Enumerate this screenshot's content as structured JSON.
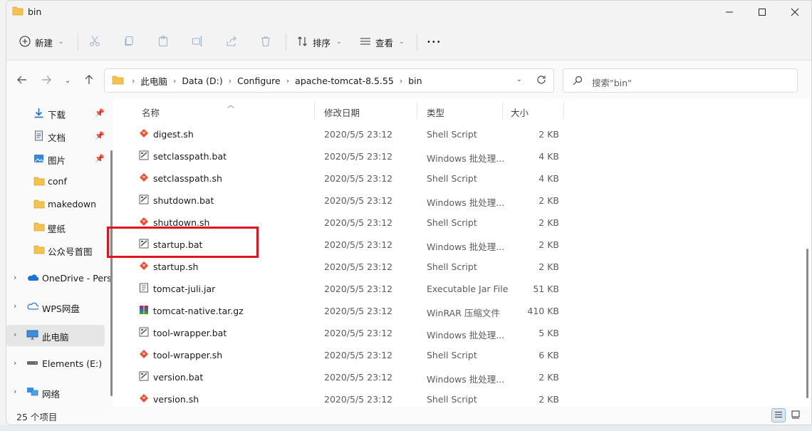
{
  "window": {
    "title": "bin"
  },
  "toolbar": {
    "new_label": "新建",
    "sort_label": "排序",
    "view_label": "查看",
    "more_label": "•••"
  },
  "address": {
    "crumbs": [
      "此电脑",
      "Data (D:)",
      "Configure",
      "apache-tomcat-8.5.55",
      "bin"
    ]
  },
  "search": {
    "placeholder": "搜索\"bin\""
  },
  "sidebar": {
    "quick": [
      {
        "label": "下载",
        "icon": "download-icon",
        "pinned": true
      },
      {
        "label": "文档",
        "icon": "document-icon",
        "pinned": true
      },
      {
        "label": "图片",
        "icon": "picture-icon",
        "pinned": true
      },
      {
        "label": "conf",
        "icon": "folder-icon"
      },
      {
        "label": "makedown",
        "icon": "folder-icon"
      },
      {
        "label": "壁纸",
        "icon": "folder-icon"
      },
      {
        "label": "公众号首图",
        "icon": "folder-icon"
      }
    ],
    "top": [
      {
        "label": "OneDrive - Pers",
        "icon": "onedrive-icon"
      },
      {
        "label": "WPS网盘",
        "icon": "wps-cloud-icon"
      },
      {
        "label": "此电脑",
        "icon": "this-pc-icon"
      },
      {
        "label": "Elements (E:)",
        "icon": "drive-icon"
      },
      {
        "label": "网络",
        "icon": "network-icon"
      }
    ]
  },
  "columns": {
    "name": "名称",
    "date": "修改日期",
    "type": "类型",
    "size": "大小"
  },
  "files": [
    {
      "name": "digest.sh",
      "date": "2020/5/5 23:12",
      "type": "Shell Script",
      "size": "2 KB",
      "icon": "shell-script-icon"
    },
    {
      "name": "setclasspath.bat",
      "date": "2020/5/5 23:12",
      "type": "Windows 批处理...",
      "size": "4 KB",
      "icon": "batch-file-icon"
    },
    {
      "name": "setclasspath.sh",
      "date": "2020/5/5 23:12",
      "type": "Shell Script",
      "size": "4 KB",
      "icon": "shell-script-icon"
    },
    {
      "name": "shutdown.bat",
      "date": "2020/5/5 23:12",
      "type": "Windows 批处理...",
      "size": "2 KB",
      "icon": "batch-file-icon"
    },
    {
      "name": "shutdown.sh",
      "date": "2020/5/5 23:12",
      "type": "Shell Script",
      "size": "2 KB",
      "icon": "shell-script-icon"
    },
    {
      "name": "startup.bat",
      "date": "2020/5/5 23:12",
      "type": "Windows 批处理...",
      "size": "2 KB",
      "icon": "batch-file-icon"
    },
    {
      "name": "startup.sh",
      "date": "2020/5/5 23:12",
      "type": "Shell Script",
      "size": "2 KB",
      "icon": "shell-script-icon"
    },
    {
      "name": "tomcat-juli.jar",
      "date": "2020/5/5 23:12",
      "type": "Executable Jar File",
      "size": "51 KB",
      "icon": "jar-file-icon"
    },
    {
      "name": "tomcat-native.tar.gz",
      "date": "2020/5/5 23:12",
      "type": "WinRAR 压缩文件",
      "size": "410 KB",
      "icon": "winrar-archive-icon"
    },
    {
      "name": "tool-wrapper.bat",
      "date": "2020/5/5 23:12",
      "type": "Windows 批处理...",
      "size": "5 KB",
      "icon": "batch-file-icon"
    },
    {
      "name": "tool-wrapper.sh",
      "date": "2020/5/5 23:12",
      "type": "Shell Script",
      "size": "6 KB",
      "icon": "shell-script-icon"
    },
    {
      "name": "version.bat",
      "date": "2020/5/5 23:12",
      "type": "Windows 批处理...",
      "size": "2 KB",
      "icon": "batch-file-icon"
    },
    {
      "name": "version.sh",
      "date": "2020/5/5 23:12",
      "type": "Shell Script",
      "size": "2 KB",
      "icon": "shell-script-icon"
    }
  ],
  "status": {
    "count_text": "25 个项目"
  },
  "colors": {
    "highlight": "#e0141e",
    "folder": "#f4c24f",
    "selected": "#e6e6e6"
  }
}
